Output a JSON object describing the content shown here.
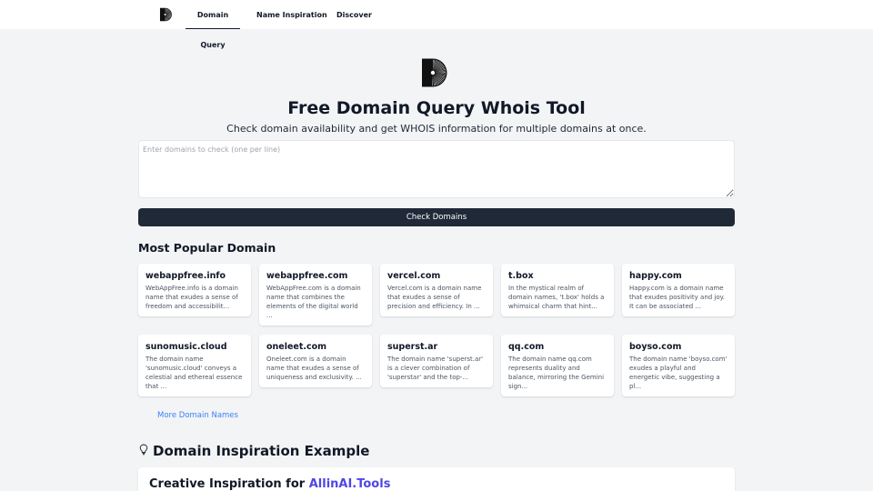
{
  "nav": {
    "logo": "sunburst-logo-icon",
    "links": [
      {
        "label": "Domain Query",
        "active": true
      },
      {
        "label": "Name Inspiration",
        "active": false
      },
      {
        "label": "Discover",
        "active": false
      }
    ]
  },
  "hero": {
    "logo": "sunburst-logo-icon",
    "title": "Free Domain Query Whois Tool",
    "subtitle": "Check domain availability and get WHOIS information for multiple domains at once."
  },
  "search": {
    "value": "",
    "placeholder": "Enter domains to check (one per line)",
    "button_label": "Check Domains"
  },
  "popular": {
    "heading": "Most Popular Domain",
    "cards": [
      {
        "name": "webappfree.info",
        "desc": "WebAppFree.info is a domain name that exudes a sense of freedom and accessibilit..."
      },
      {
        "name": "webappfree.com",
        "desc": "WebAppFree.com is a domain name that combines the elements of the digital world ..."
      },
      {
        "name": "vercel.com",
        "desc": "Vercel.com is a domain name that exudes a sense of precision and efficiency. In ..."
      },
      {
        "name": "t.box",
        "desc": "In the mystical realm of domain names, 't.box' holds a whimsical charm that hint..."
      },
      {
        "name": "happy.com",
        "desc": "Happy.com is a domain name that exudes positivity and joy. It can be associated ..."
      },
      {
        "name": "sunomusic.cloud",
        "desc": "The domain name 'sunomusic.cloud' conveys a celestial and ethereal essence that ..."
      },
      {
        "name": "oneleet.com",
        "desc": "Oneleet.com is a domain name that exudes a sense of uniqueness and exclusivity. ..."
      },
      {
        "name": "superst.ar",
        "desc": "The domain name 'superst.ar' is a clever combination of 'superstar' and the top-..."
      },
      {
        "name": "qq.com",
        "desc": "The domain name qq.com represents duality and balance, mirroring the Gemini sign..."
      },
      {
        "name": "boyso.com",
        "desc": "The domain name 'boyso.com' exudes a playful and energetic vibe, suggesting a pl..."
      }
    ],
    "more_label": "More Domain Names"
  },
  "inspiration": {
    "icon": "lightbulb-icon",
    "heading": "Domain Inspiration Example",
    "card_title_prefix": "Creative Inspiration for",
    "card_title_brand": "AllinAI.Tools"
  },
  "colors": {
    "page_bg": "#f3f4f6",
    "button_bg": "#1f2937",
    "link": "#3b82f6",
    "brand_accent": "#4f46e5"
  }
}
